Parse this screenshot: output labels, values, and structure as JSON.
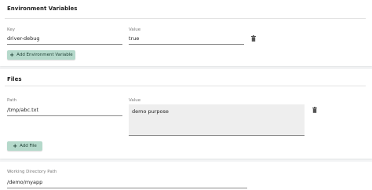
{
  "env": {
    "title": "Environment Variables",
    "key_label": "Key",
    "value_label": "Value",
    "key_value": "driver-debug",
    "value_value": "true",
    "add_label": "Add Environment Variable"
  },
  "files": {
    "title": "Files",
    "path_label": "Path",
    "value_label": "Value",
    "path_value": "/tmp/abc.txt",
    "content_value": "demo purpose",
    "add_label": "Add File"
  },
  "workdir": {
    "label": "Working Directory Path",
    "value": "/demo/myapp"
  },
  "icons": {
    "trash": "trash-icon",
    "plus": "plus-icon"
  },
  "colors": {
    "button_bg": "#b5d9cb",
    "page_bg": "#f4f5f6"
  }
}
